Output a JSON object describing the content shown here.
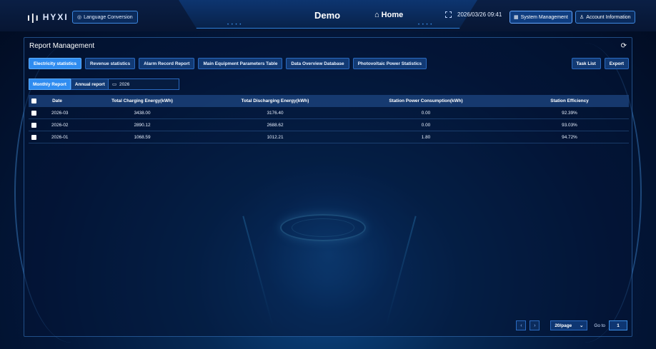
{
  "header": {
    "logo": "HYXI",
    "language_button": "Language Conversion",
    "title": "Demo",
    "home": "Home",
    "datetime": "2026/03/26 09:41",
    "system_management": "System Management",
    "account_information": "Account Information"
  },
  "panel": {
    "title": "Report Management",
    "tabs": [
      {
        "label": "Electricity statistics",
        "active": true
      },
      {
        "label": "Revenue statistics",
        "active": false
      },
      {
        "label": "Alarm Record Report",
        "active": false
      },
      {
        "label": "Main Equipment Parameters Table",
        "active": false
      },
      {
        "label": "Data Overview Database",
        "active": false
      },
      {
        "label": "Photovoltaic Power Statistics",
        "active": false
      }
    ],
    "task_list": "Task List",
    "export": "Export",
    "report_types": [
      {
        "label": "Monthly Report",
        "active": true
      },
      {
        "label": "Annual report",
        "active": false
      }
    ],
    "year": "2026"
  },
  "table": {
    "columns": [
      "Date",
      "Total Charging Energy(kWh)",
      "Total Discharging Energy(kWh)",
      "Station Power Consumption(kWh)",
      "Station Efficiency"
    ],
    "rows": [
      [
        "2026-03",
        "3438.00",
        "3176.40",
        "0.00",
        "92.39%"
      ],
      [
        "2026-02",
        "2890.12",
        "2688.62",
        "0.00",
        "93.03%"
      ],
      [
        "2026-01",
        "1068.59",
        "1012.21",
        "1.80",
        "94.72%"
      ]
    ]
  },
  "pagination": {
    "page_size": "20/page",
    "goto_label": "Go to",
    "page": "1"
  },
  "colors": {
    "accent": "#2f8cf0",
    "background": "#03173a",
    "tab_inactive": "#123a74"
  }
}
